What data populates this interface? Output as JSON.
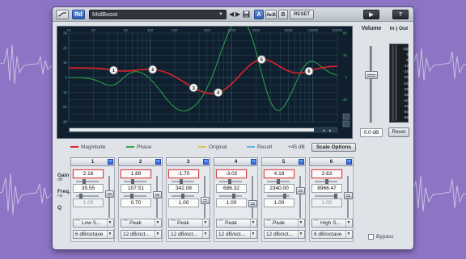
{
  "toolbar": {
    "rd_label": "Rd",
    "preset_name": "MidBoost",
    "ab_a": "A",
    "ab_copy": "A▸B",
    "ab_b": "B",
    "reset_label": "RESET",
    "help_label": "?"
  },
  "graph": {
    "freq_ticks": [
      "10",
      "20",
      "50",
      "100",
      "200",
      "500",
      "1000",
      "2000",
      "5000",
      "10000",
      "20000"
    ],
    "gain_ticks_left": [
      "30",
      "20",
      "10",
      "0",
      "-10",
      "-20",
      "-30"
    ],
    "phase_ticks_right": [
      "90",
      "45",
      "0",
      "-45",
      "-90"
    ],
    "node_labels": [
      "1",
      "2",
      "3",
      "4",
      "5",
      "6"
    ],
    "colors": {
      "magnitude": "#e0212b",
      "phase": "#2ea84a",
      "original": "#d6c64a",
      "result": "#5fb4d6",
      "grid": "#32556f",
      "bg": "#0f1f2d"
    }
  },
  "legend": {
    "magnitude": "Magnitude",
    "phase": "Phase",
    "original": "Original",
    "result": "Result",
    "range": "+45 dB",
    "scale_options": "Scale Options"
  },
  "volume": {
    "label": "Volume",
    "value": "0.0 dB",
    "level": 0.62
  },
  "io": {
    "label_in": "In",
    "label_out": "Out",
    "scale": [
      "clip",
      "0",
      "-5",
      "-10",
      "-15",
      "-20",
      "-25",
      "-30",
      "-35",
      "-40",
      "-45",
      "-50",
      "-55"
    ],
    "reset_label": "Reset"
  },
  "row_labels": {
    "gain": "Gain",
    "gain_unit": "dB",
    "freq": "Freq.",
    "freq_unit": "Hz",
    "q": "Q"
  },
  "bands": [
    {
      "num": "1",
      "gain": "2.16",
      "freq": "35.55",
      "q": "1.00",
      "q_dim": true,
      "type": "Low S...",
      "slope": "6 dB/octave"
    },
    {
      "num": "2",
      "gain": "1.89",
      "freq": "107.51",
      "q": "0.70",
      "q_dim": false,
      "type": "Peak",
      "slope": "12 dB/oct..."
    },
    {
      "num": "3",
      "gain": "-1.70",
      "freq": "342.08",
      "q": "1.00",
      "q_dim": false,
      "type": "Peak",
      "slope": "12 dB/oct..."
    },
    {
      "num": "4",
      "gain": "-3.02",
      "freq": "686.32",
      "q": "1.00",
      "q_dim": false,
      "type": "Peak",
      "slope": "12 dB/oct..."
    },
    {
      "num": "5",
      "gain": "4.18",
      "freq": "2340.00",
      "q": "1.00",
      "q_dim": false,
      "type": "Peak",
      "slope": "12 dB/oct..."
    },
    {
      "num": "6",
      "gain": "2.63",
      "freq": "8966.47",
      "q": "1.00",
      "q_dim": true,
      "type": "High S...",
      "slope": "6 dB/octave"
    }
  ],
  "bypass_label": "Bypass"
}
